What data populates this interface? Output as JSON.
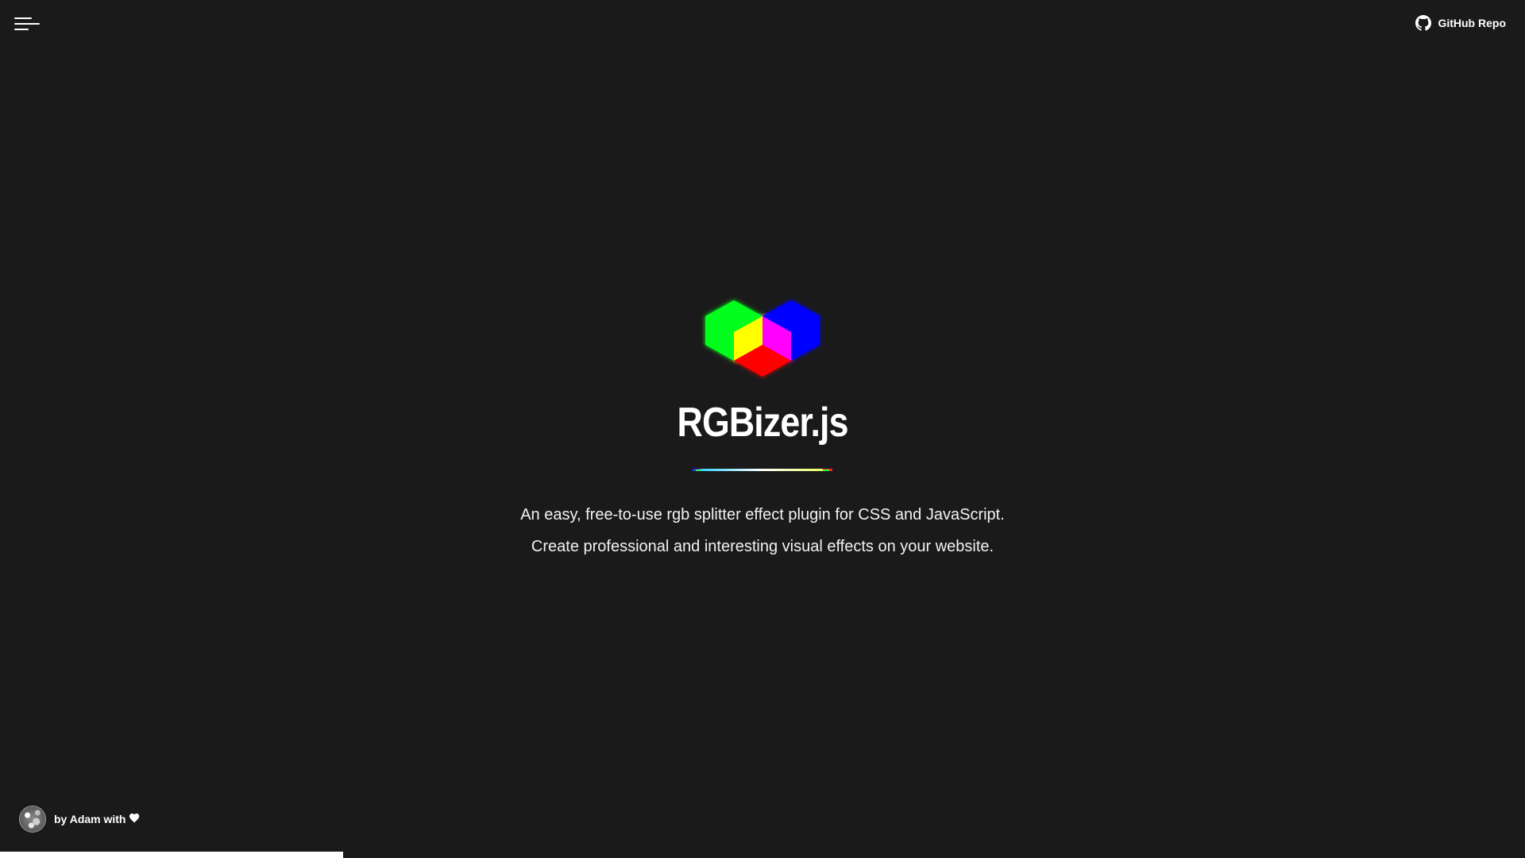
{
  "header": {
    "menu_icon": "hamburger-menu-icon",
    "github_icon": "github-icon",
    "github_label": "GitHub Repo"
  },
  "hero": {
    "logo_icon": "rgb-hexagon-logo-icon",
    "title": "RGBizer.js",
    "tagline_line1": "An easy, free-to-use rgb splitter effect plugin for CSS and JavaScript.",
    "tagline_line2": "Create professional and interesting visual effects on your website."
  },
  "footer": {
    "credit_text": "by Adam with",
    "heart_icon": "heart-icon",
    "avatar_icon": "avatar"
  },
  "progress": {
    "value_percent": 22.5
  },
  "colors": {
    "background": "#1a1a1a",
    "text": "#ffffff",
    "logo_green": "#00ff1e",
    "logo_blue": "#0000ff",
    "logo_red": "#ff0000",
    "logo_yellow": "#ffff00",
    "logo_magenta": "#ff00ff"
  }
}
